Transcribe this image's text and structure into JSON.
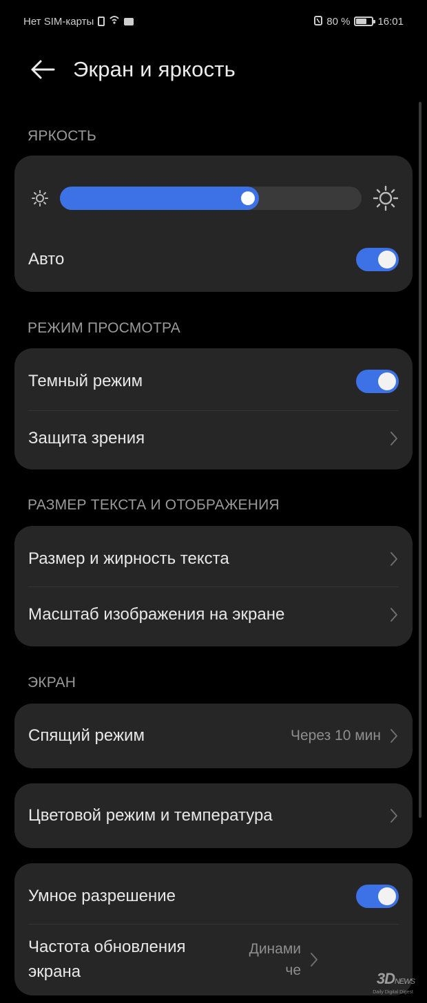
{
  "status_bar": {
    "carrier": "Нет SIM-карты",
    "battery_percent": "80 %",
    "time": "16:01",
    "battery_level": 0.8
  },
  "header": {
    "title": "Экран и яркость"
  },
  "sections": {
    "brightness": "ЯРКОСТЬ",
    "view_mode": "РЕЖИМ ПРОСМОТРА",
    "text_size": "РАЗМЕР ТЕКСТА И ОТОБРАЖЕНИЯ",
    "screen": "ЭКРАН"
  },
  "brightness": {
    "level": 0.66,
    "auto_label": "Авто",
    "auto_enabled": true
  },
  "view_mode": {
    "dark_mode_label": "Темный режим",
    "dark_mode_enabled": true,
    "eye_comfort_label": "Защита зрения"
  },
  "text_display": {
    "text_size_label": "Размер и жирность текста",
    "display_scale_label": "Масштаб изображения на экране"
  },
  "screen": {
    "sleep_label": "Спящий режим",
    "sleep_value": "Через 10 мин",
    "color_mode_label": "Цветовой режим и температура",
    "smart_resolution_label": "Умное разрешение",
    "smart_resolution_enabled": true,
    "refresh_rate_label": "Частота обновления экрана",
    "refresh_rate_value": "Динами че"
  },
  "watermark": {
    "brand": "3D",
    "brand_suffix": "NEWS",
    "tagline": "Daily Digital Digest"
  },
  "colors": {
    "accent": "#3d72e6",
    "card": "#262626",
    "background": "#000000"
  },
  "icons": [
    "sim-icon",
    "mail-icon",
    "nfc-icon",
    "battery-icon",
    "back-arrow-icon",
    "sun-small-icon",
    "sun-large-icon",
    "chevron-right-icon"
  ]
}
